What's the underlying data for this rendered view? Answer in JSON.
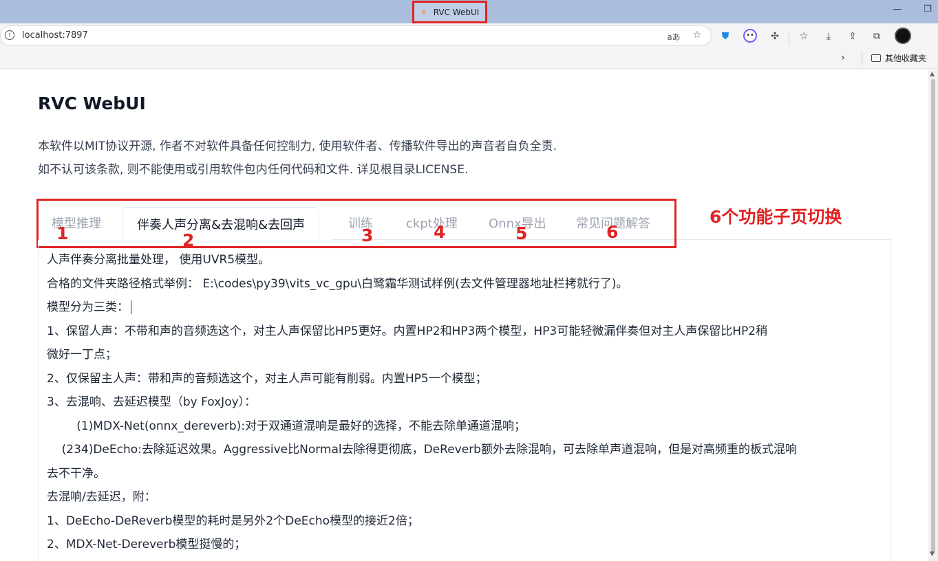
{
  "browser": {
    "window_title": "RVC WebUI",
    "url": "localhost:7897",
    "bookmarks_folder": "其他收藏夹"
  },
  "page": {
    "title": "RVC WebUI",
    "description_line1": "本软件以MIT协议开源, 作者不对软件具备任何控制力, 使用软件者、传播软件导出的声音者自负全责.",
    "description_line2": "如不认可该条款, 则不能使用或引用软件包内任何代码和文件. 详见根目录LICENSE."
  },
  "tabs": [
    {
      "label": "模型推理",
      "active": false
    },
    {
      "label": "伴奏人声分离&去混响&去回声",
      "active": true
    },
    {
      "label": "训练",
      "active": false
    },
    {
      "label": "ckpt处理",
      "active": false
    },
    {
      "label": "Onnx导出",
      "active": false
    },
    {
      "label": "常见问题解答",
      "active": false
    }
  ],
  "annotation": {
    "label": "6个功能子页切换",
    "numbers": [
      "1",
      "2",
      "3",
      "4",
      "5",
      "6"
    ],
    "color": "#e02424"
  },
  "content_lines": [
    "人声伴奏分离批量处理， 使用UVR5模型。",
    "合格的文件夹路径格式举例： E:\\codes\\py39\\vits_vc_gpu\\白鹭霜华测试样例(去文件管理器地址栏拷就行了)。",
    "模型分为三类：",
    "1、保留人声：不带和声的音频选这个，对主人声保留比HP5更好。内置HP2和HP3两个模型，HP3可能轻微漏伴奏但对主人声保留比HP2稍",
    "微好一丁点；",
    "2、仅保留主人声：带和声的音频选这个，对主人声可能有削弱。内置HP5一个模型；",
    "3、去混响、去延迟模型（by FoxJoy）：",
    "        (1)MDX-Net(onnx_dereverb):对于双通道混响是最好的选择，不能去除单通道混响；",
    "    (234)DeEcho:去除延迟效果。Aggressive比Normal去除得更彻底，DeReverb额外去除混响，可去除单声道混响，但是对高频重的板式混响",
    "去不干净。",
    "去混响/去延迟，附：",
    "1、DeEcho-DeReverb模型的耗时是另外2个DeEcho模型的接近2倍；",
    "2、MDX-Net-Dereverb模型挺慢的；"
  ]
}
